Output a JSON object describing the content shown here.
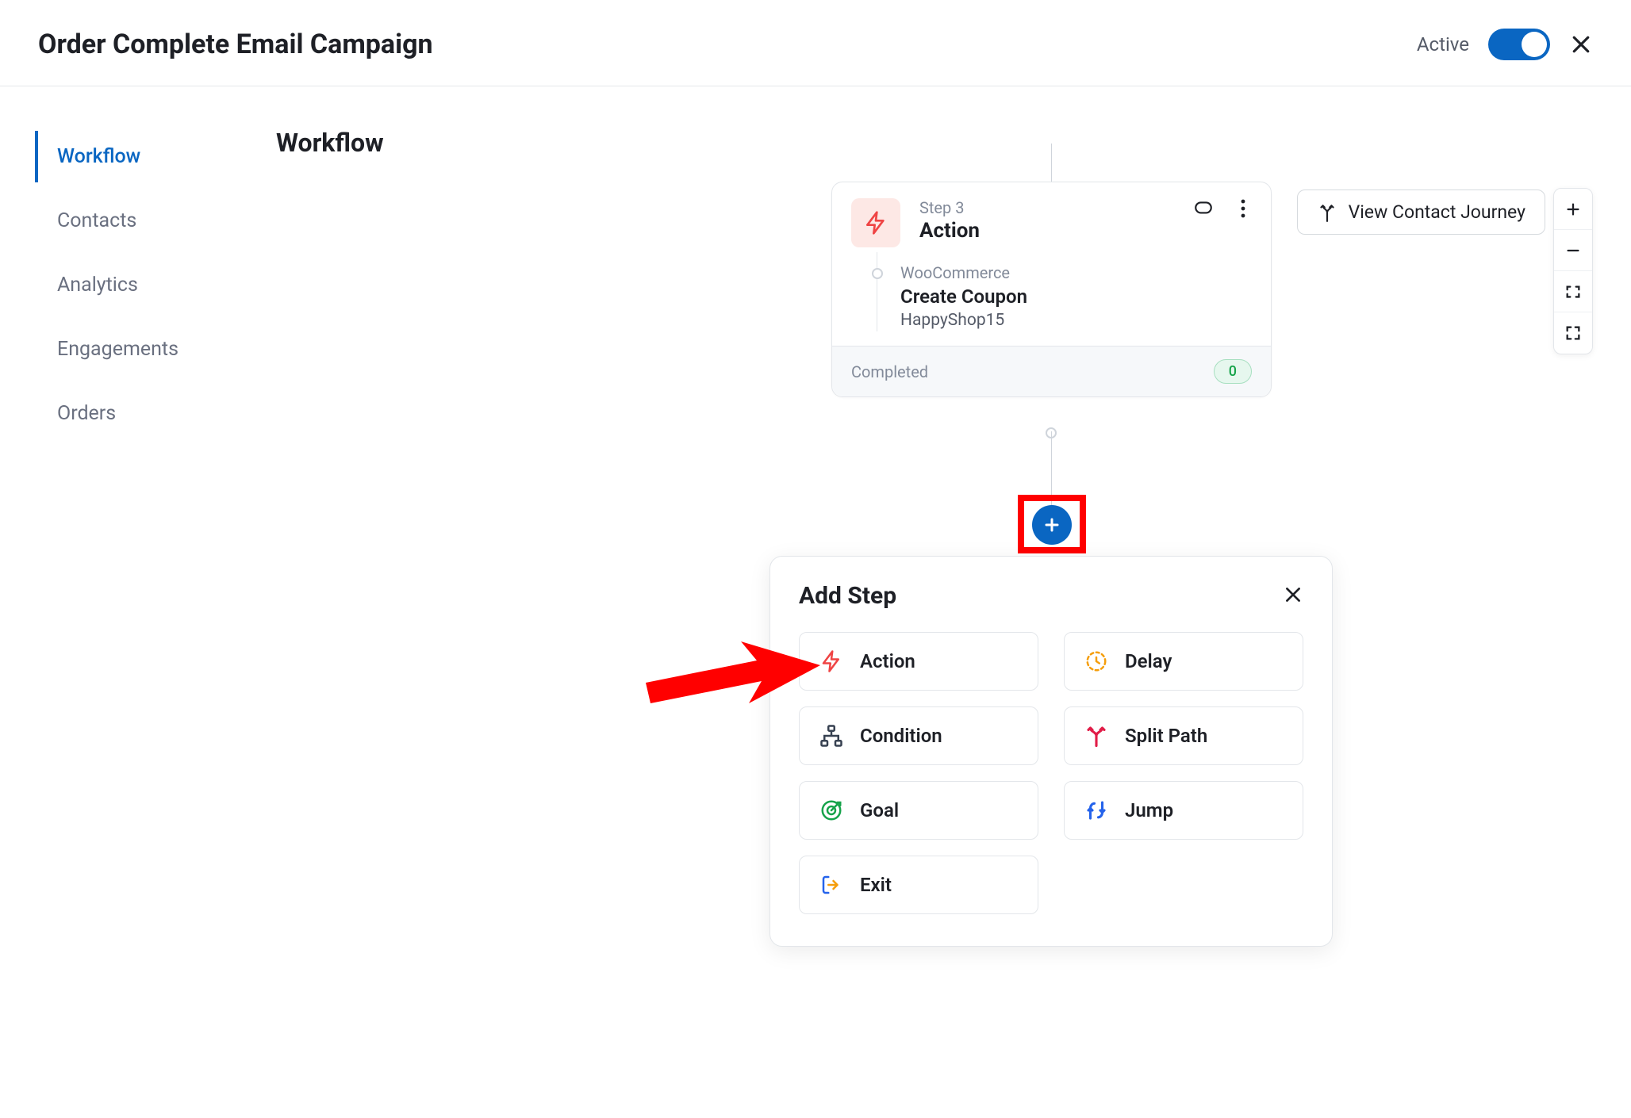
{
  "header": {
    "title": "Order Complete Email Campaign",
    "active_label": "Active",
    "active_state": true
  },
  "sidebar": {
    "items": [
      {
        "label": "Workflow",
        "active": true
      },
      {
        "label": "Contacts",
        "active": false
      },
      {
        "label": "Analytics",
        "active": false
      },
      {
        "label": "Engagements",
        "active": false
      },
      {
        "label": "Orders",
        "active": false
      }
    ]
  },
  "content": {
    "title": "Workflow"
  },
  "action_card": {
    "step_label": "Step 3",
    "step_title": "Action",
    "category": "WooCommerce",
    "action_name": "Create Coupon",
    "action_value": "HappyShop15",
    "footer_label": "Completed",
    "footer_count": "0"
  },
  "popover": {
    "title": "Add Step",
    "options": [
      {
        "label": "Action",
        "icon": "bolt"
      },
      {
        "label": "Delay",
        "icon": "clock"
      },
      {
        "label": "Condition",
        "icon": "sitemap"
      },
      {
        "label": "Split Path",
        "icon": "split"
      },
      {
        "label": "Goal",
        "icon": "target"
      },
      {
        "label": "Jump",
        "icon": "jump"
      },
      {
        "label": "Exit",
        "icon": "exit"
      }
    ]
  },
  "journey_button": "View Contact Journey",
  "colors": {
    "primary": "#0a66c2",
    "highlight": "#ff0000",
    "action_icon": "#ef4444",
    "delay_icon": "#f59e0b",
    "condition_icon": "#374151",
    "split_icon": "#e11d48",
    "goal_icon": "#16a34a",
    "jump_icon": "#2563eb",
    "exit_icon": "#2563eb"
  }
}
